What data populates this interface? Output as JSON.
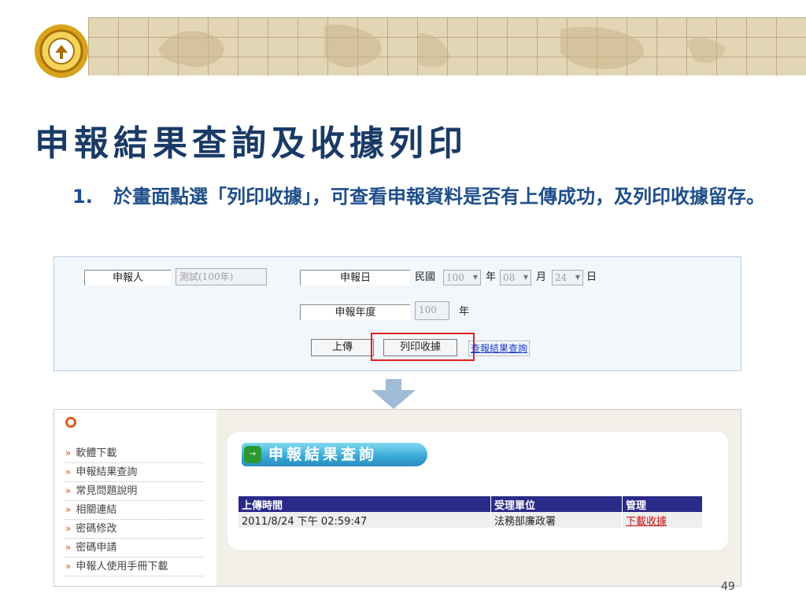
{
  "slide": {
    "title": "申報結果查詢及收據列印",
    "step_number": "1.",
    "step_text": "於畫面點選「列印收據」，可查看申報資料是否有上傳成功，及列印收據留存。",
    "page_number": "49"
  },
  "form": {
    "applicant_label": "申報人",
    "applicant_value": "測試(100年)",
    "report_date_label": "申報日",
    "era_label": "民國",
    "year_value": "100",
    "year_unit": "年",
    "month_value": "08",
    "month_unit": "月",
    "day_value": "24",
    "day_unit": "日",
    "report_year_label": "申報年度",
    "report_year_value": "100",
    "report_year_unit": "年",
    "upload_button": "上傳",
    "print_receipt_button": "列印收據",
    "query_result_link": "查報結果查詢"
  },
  "sidebar": {
    "items": [
      {
        "label": "軟體下載"
      },
      {
        "label": "申報結果查詢"
      },
      {
        "label": "常見問題說明"
      },
      {
        "label": "相關連結"
      },
      {
        "label": "密碼修改"
      },
      {
        "label": "密碼申請"
      },
      {
        "label": "申報人使用手冊下載"
      }
    ]
  },
  "result": {
    "header": "申報結果查詢",
    "columns": [
      "上傳時間",
      "受理單位",
      "管理"
    ],
    "rows": [
      {
        "time": "2011/8/24 下午 02:59:47",
        "unit": "法務部廉政署",
        "action": "下載收據"
      }
    ]
  },
  "colors": {
    "title": "#1a3a66",
    "step": "#1f4e8a",
    "highlight": "#e02020",
    "table_header": "#2a2a88",
    "bullet": "#e05a20"
  }
}
